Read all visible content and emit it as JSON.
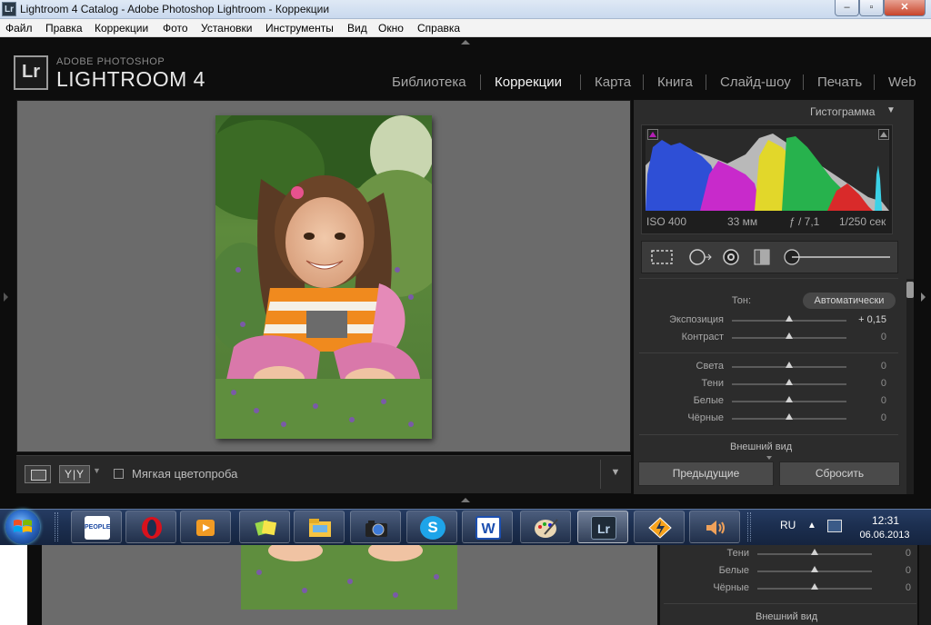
{
  "window": {
    "title": "Lightroom 4 Catalog - Adobe Photoshop Lightroom - Коррекции",
    "app_icon": "Lr",
    "controls": [
      "minimize-icon",
      "maximize-icon",
      "close-icon"
    ]
  },
  "menu": [
    "Файл",
    "Правка",
    "Коррекции",
    "Фото",
    "Установки",
    "Инструменты",
    "Вид",
    "Окно",
    "Справка"
  ],
  "brand": {
    "logo": "Lr",
    "top": "ADOBE PHOTOSHOP",
    "main": "LIGHTROOM 4"
  },
  "modules": [
    {
      "label": "Библиотека",
      "active": false
    },
    {
      "label": "Коррекции",
      "active": true
    },
    {
      "label": "Карта",
      "active": false
    },
    {
      "label": "Книга",
      "active": false
    },
    {
      "label": "Слайд-шоу",
      "active": false
    },
    {
      "label": "Печать",
      "active": false
    },
    {
      "label": "Web",
      "active": false
    }
  ],
  "toolbar": {
    "yy_label": "Y|Y",
    "softproof_label": "Мягкая цветопроба",
    "softproof_checked": false
  },
  "histogram": {
    "header": "Гистограмма",
    "exif": {
      "iso": "ISO 400",
      "focal": "33 мм",
      "aperture": "ƒ / 7,1",
      "shutter": "1/250 сек"
    }
  },
  "tone": {
    "label": "Тон:",
    "auto_label": "Автоматически",
    "sliders": [
      {
        "label": "Экспозиция",
        "value": "+ 0,15",
        "level": 0.5
      },
      {
        "label": "Контраст",
        "value": "0",
        "level": 0.5
      },
      {
        "label": "Света",
        "value": "0",
        "level": 0.5
      },
      {
        "label": "Тени",
        "value": "0",
        "level": 0.5
      },
      {
        "label": "Белые",
        "value": "0",
        "level": 0.5
      },
      {
        "label": "Чёрные",
        "value": "0",
        "level": 0.5
      }
    ]
  },
  "section_vneshniy": "Внешний вид",
  "buttons": {
    "prev": "Предыдущие",
    "reset": "Сбросить"
  },
  "taskbar": {
    "apps": [
      "people-icon",
      "opera-icon",
      "media-player-icon",
      "sticky-notes-icon",
      "file-explorer-icon",
      "camera-icon",
      "skype-icon",
      "word-icon",
      "paint-icon",
      "lightroom-icon",
      "aimp-icon",
      "volume-icon"
    ],
    "people_label": "PEOPLE",
    "lang": "RU",
    "time": "12:31",
    "date": "06.06.2013"
  },
  "below": {
    "sliders": [
      {
        "label": "Тени",
        "value": "0"
      },
      {
        "label": "Белые",
        "value": "0"
      },
      {
        "label": "Чёрные",
        "value": "0"
      }
    ],
    "section": "Внешний вид"
  }
}
